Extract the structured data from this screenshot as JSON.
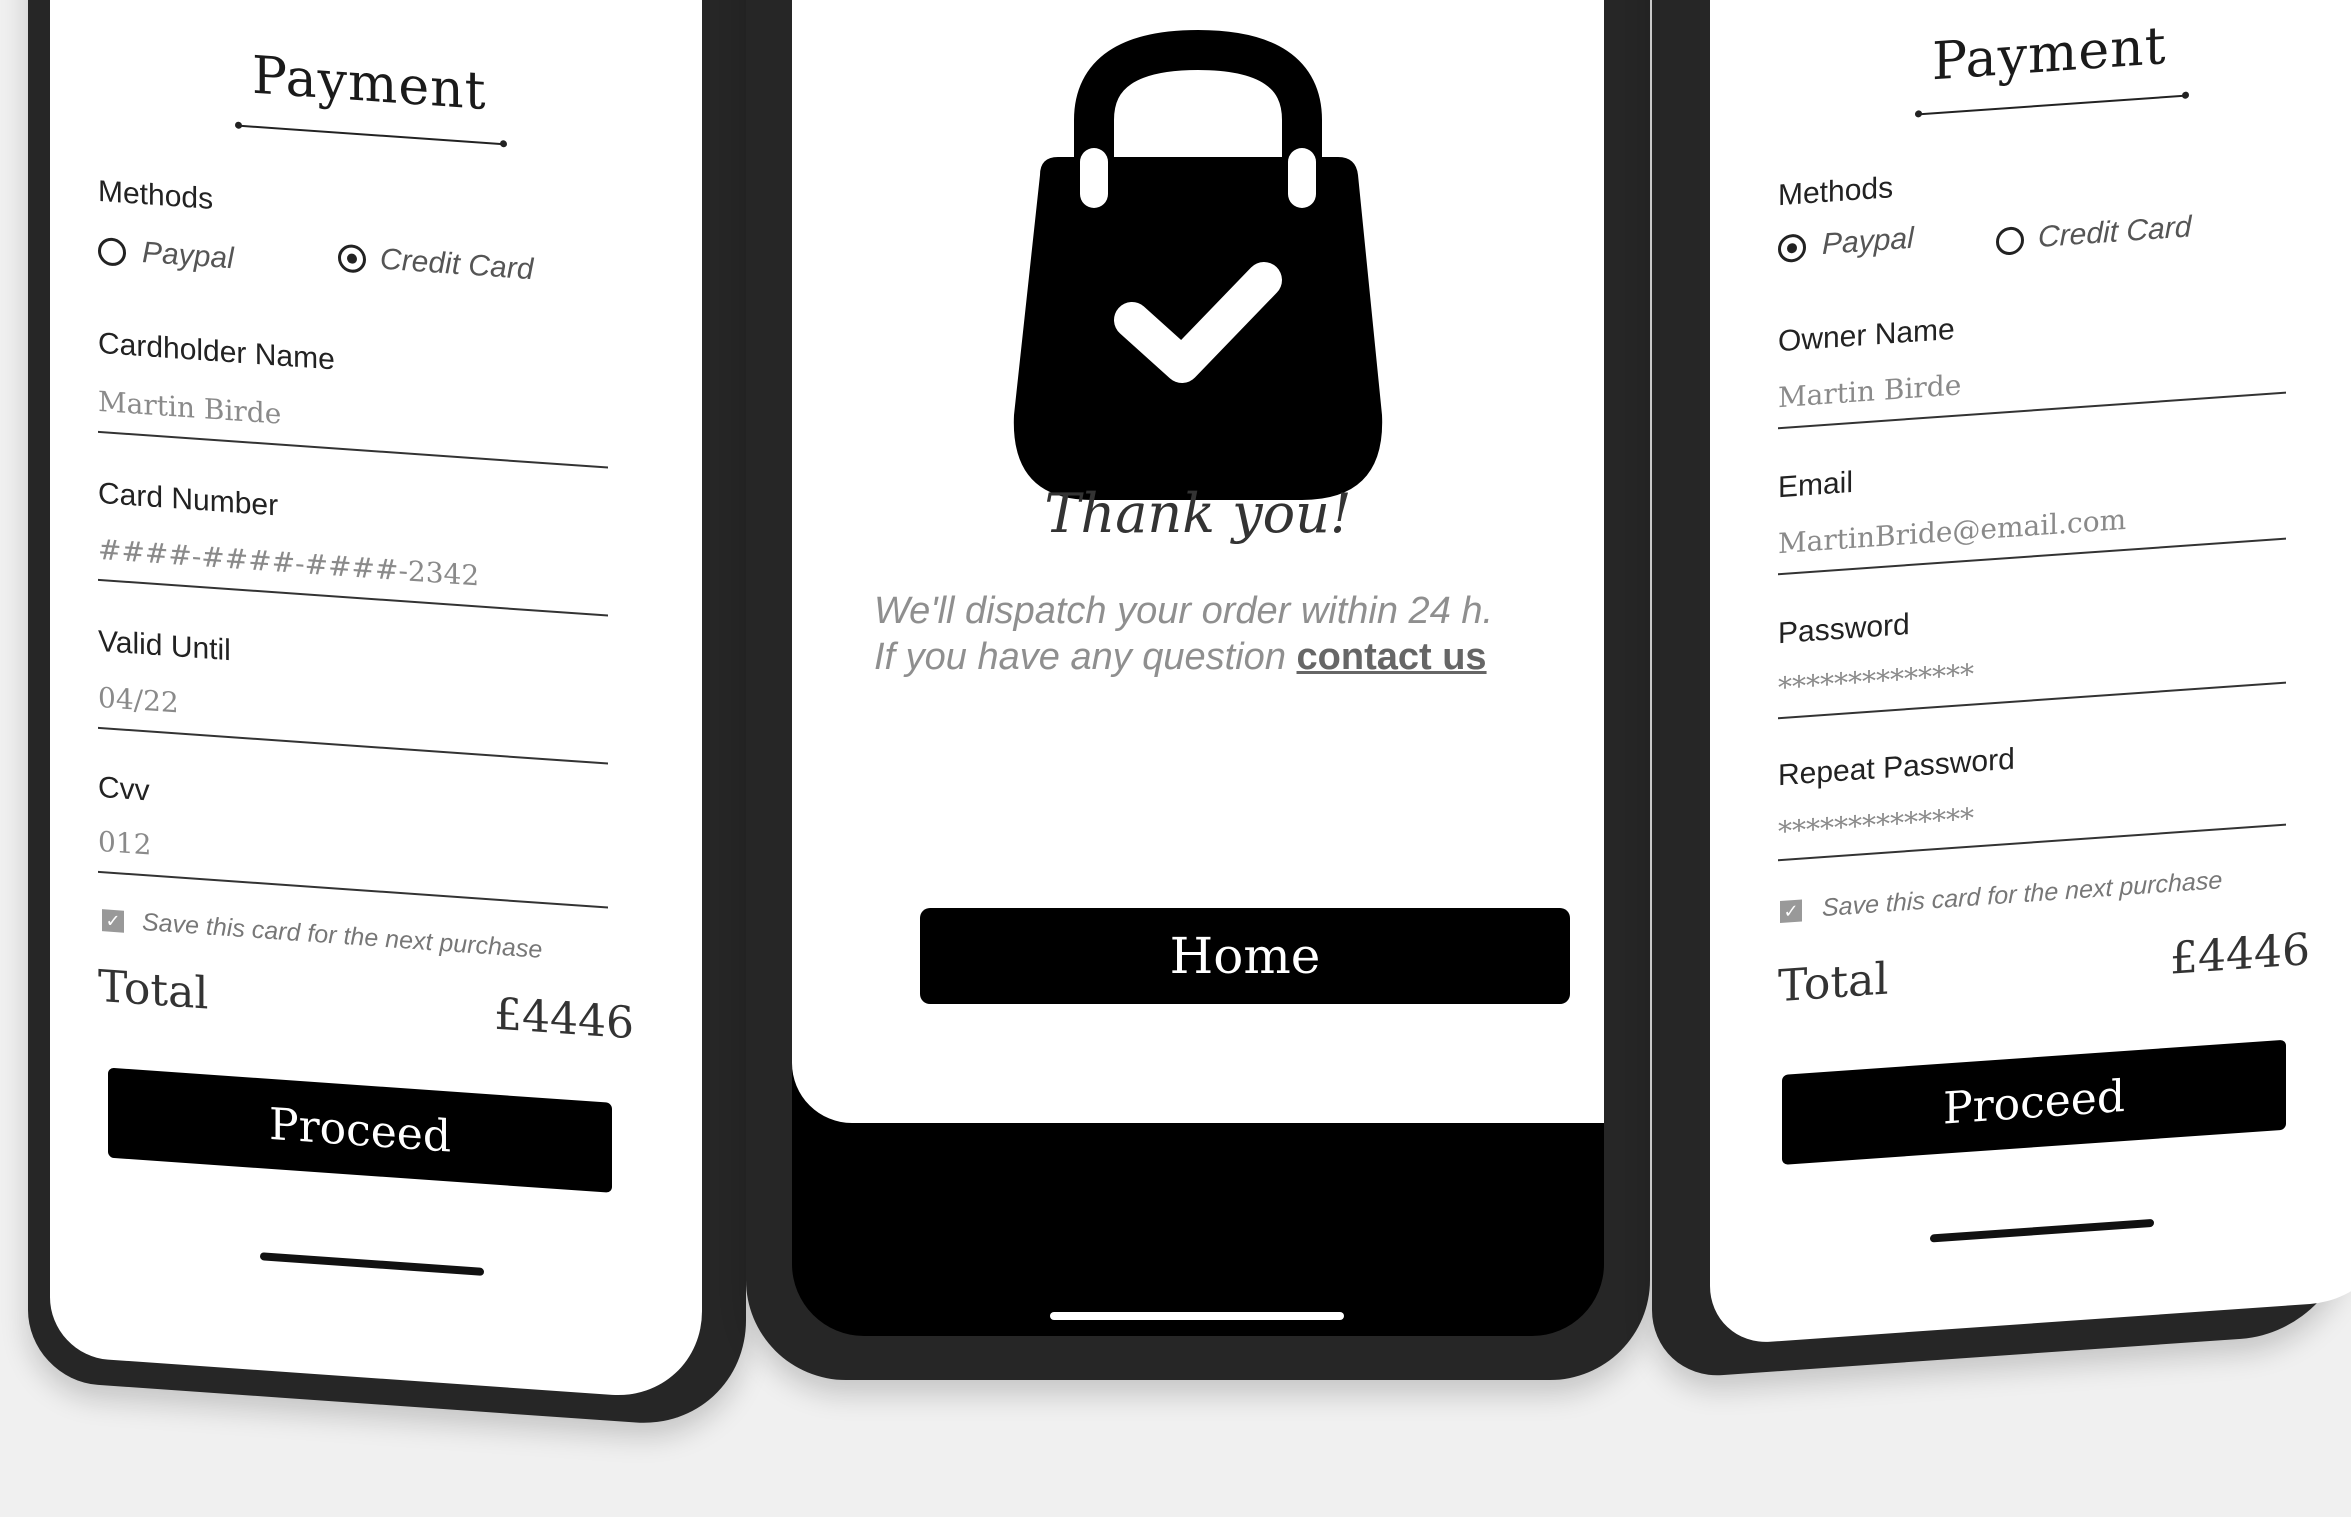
{
  "left_screen": {
    "title": "Payment",
    "methods_label": "Methods",
    "methods": [
      {
        "label": "Paypal",
        "selected": false
      },
      {
        "label": "Credit Card",
        "selected": true
      }
    ],
    "fields": [
      {
        "label": "Cardholder Name",
        "value": "Martin Birde"
      },
      {
        "label": "Card Number",
        "value": "####-####-####-2342"
      },
      {
        "label": "Valid Until",
        "value": "04/22"
      },
      {
        "label": "Cvv",
        "value": "012"
      }
    ],
    "save_card_text": "Save this card for the next purchase",
    "save_card_checked": true,
    "total_label": "Total",
    "total_value": "£4446",
    "proceed_label": "Proceed"
  },
  "center_screen": {
    "bag_icon": "shopping-bag-check-icon",
    "thanks": "Thank you!",
    "dispatch_line1": "We'll dispatch your order within 24 h.",
    "dispatch_line2": "If you have any question",
    "contact_link": "contact us",
    "home_button": "Home"
  },
  "right_screen": {
    "title": "Payment",
    "methods_label": "Methods",
    "methods": [
      {
        "label": "Paypal",
        "selected": true
      },
      {
        "label": "Credit Card",
        "selected": false
      }
    ],
    "fields": [
      {
        "label": "Owner Name",
        "value": "Martin Birde"
      },
      {
        "label": "Email",
        "value": "MartinBride@email.com"
      },
      {
        "label": "Password",
        "value": "**************"
      },
      {
        "label": "Repeat Password",
        "value": "**************"
      }
    ],
    "save_card_text": "Save this card for the next purchase",
    "save_card_checked": true,
    "total_label": "Total",
    "total_value": "£4446",
    "proceed_label": "Proceed"
  },
  "colors": {
    "background": "#f0f0f0",
    "phone_frame": "#262626",
    "button": "#000000",
    "button_text": "#ffffff"
  }
}
